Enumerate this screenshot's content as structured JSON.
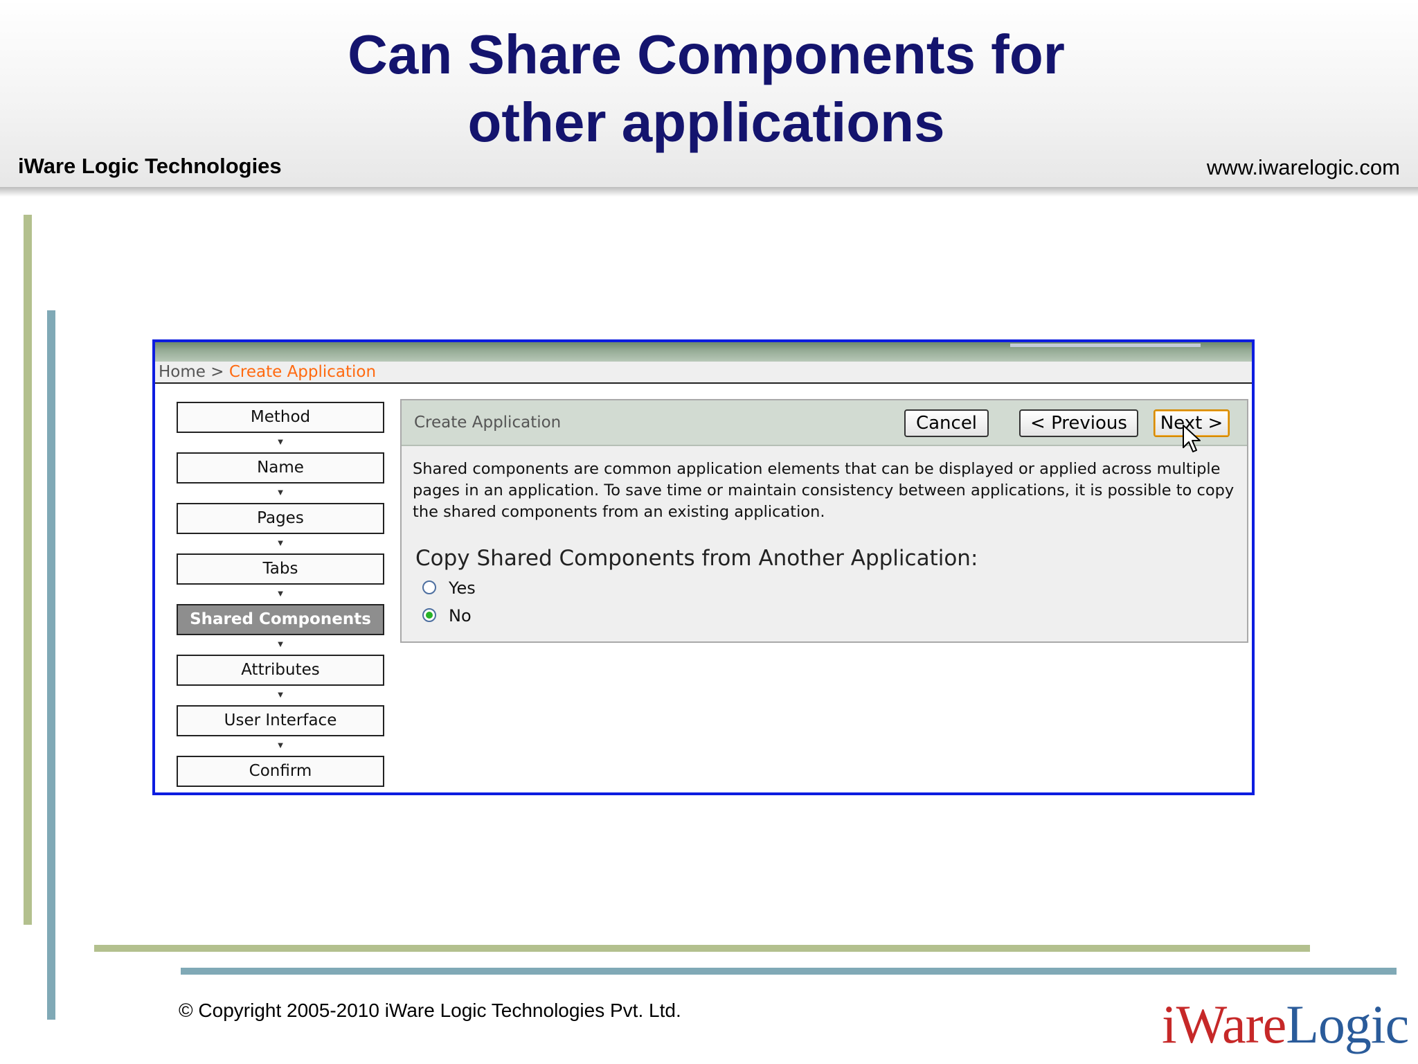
{
  "slide": {
    "title_line1": "Can Share Components for",
    "title_line2": "other applications",
    "company": "iWare Logic Technologies",
    "website": "www.iwarelogic.com",
    "copyright": "© Copyright 2005-2010 iWare Logic Technologies Pvt. Ltd.",
    "logo_part1": "iWare",
    "logo_part2": "Logic"
  },
  "app": {
    "breadcrumb": {
      "home": "Home",
      "separator": ">",
      "current": "Create Application"
    },
    "wizard_steps": [
      {
        "label": "Method",
        "active": false
      },
      {
        "label": "Name",
        "active": false
      },
      {
        "label": "Pages",
        "active": false
      },
      {
        "label": "Tabs",
        "active": false
      },
      {
        "label": "Shared Components",
        "active": true
      },
      {
        "label": "Attributes",
        "active": false
      },
      {
        "label": "User Interface",
        "active": false
      },
      {
        "label": "Confirm",
        "active": false
      }
    ],
    "panel": {
      "title": "Create Application",
      "cancel_label": "Cancel",
      "previous_label": "< Previous",
      "next_label": "Next >",
      "description": "Shared components are common application elements that can be displayed or applied across multiple pages in an application. To save time or maintain consistency between applications, it is possible to copy the shared components from an existing application.",
      "copy_label": "Copy Shared Components from Another Application:",
      "options": [
        {
          "label": "Yes",
          "checked": false
        },
        {
          "label": "No",
          "checked": true
        }
      ]
    }
  },
  "colors": {
    "title": "#14146e",
    "frame_border": "#0d1de0",
    "breadcrumb_current": "#ff6a10",
    "active_step": "#8e8e8e",
    "accent_green": "#b3c08e",
    "accent_teal": "#80a9b6",
    "logo_red": "#c62828",
    "logo_blue": "#2a5b9a"
  }
}
